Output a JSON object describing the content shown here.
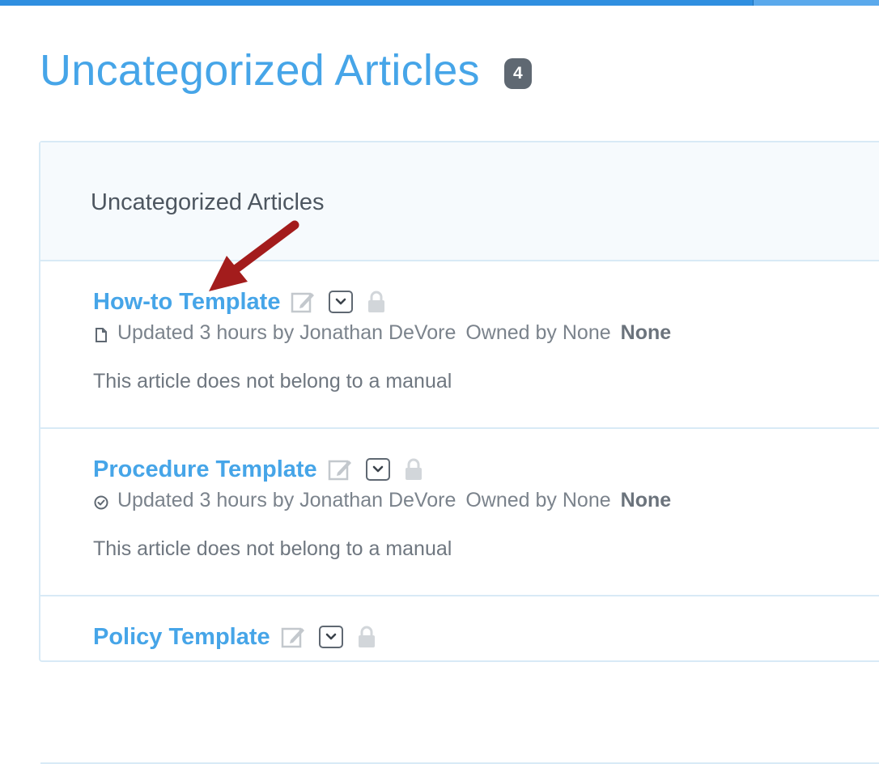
{
  "page": {
    "title": "Uncategorized Articles",
    "count": "4"
  },
  "panel": {
    "header_title": "Uncategorized Articles"
  },
  "articles": [
    {
      "title": "How-to Template",
      "updated": "Updated 3 hours by Jonathan DeVore",
      "owned": "Owned by None",
      "status": "None",
      "note": "This article does not belong to a manual",
      "status_icon": "document-icon"
    },
    {
      "title": "Procedure Template",
      "updated": "Updated 3 hours by Jonathan DeVore",
      "owned": "Owned by None",
      "status": "None",
      "note": "This article does not belong to a manual",
      "status_icon": "check-circle-icon"
    },
    {
      "title": "Policy Template",
      "updated": "",
      "owned": "",
      "status": "",
      "note": "",
      "status_icon": ""
    }
  ],
  "colors": {
    "accent": "#46a5e8",
    "top_bar": "#2f8fe0",
    "badge": "#5f6872",
    "annotation_arrow": "#a31c1c"
  }
}
